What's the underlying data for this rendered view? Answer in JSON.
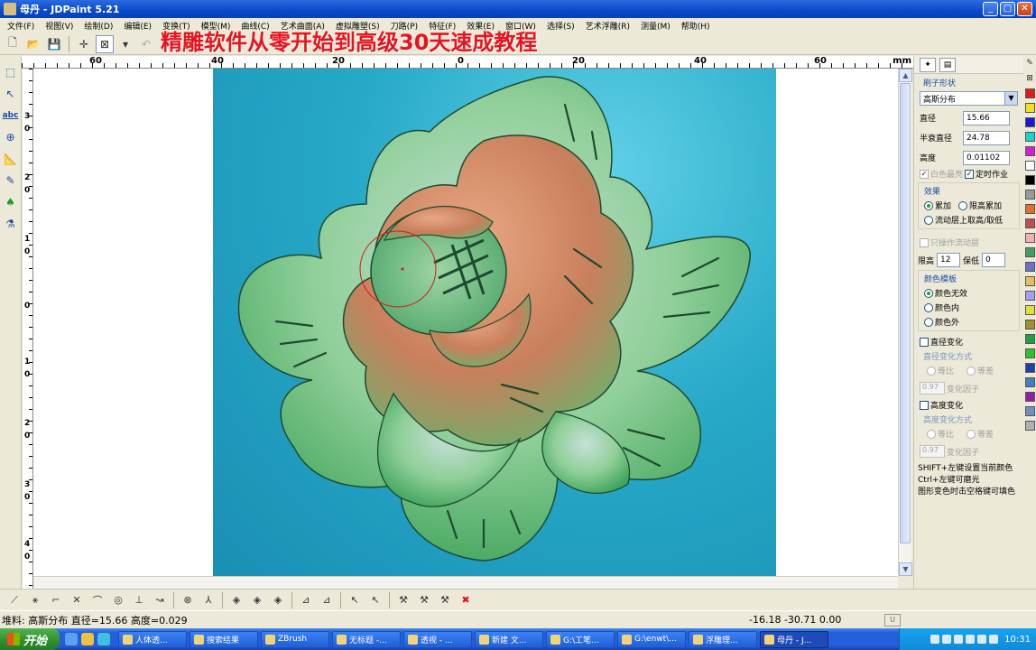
{
  "window": {
    "title": "母丹 - JDPaint 5.21"
  },
  "menu": [
    "文件(F)",
    "视图(V)",
    "绘制(D)",
    "编辑(E)",
    "变换(T)",
    "模型(M)",
    "曲线(C)",
    "艺术曲面(A)",
    "虚拟雕塑(S)",
    "刀路(P)",
    "特征(F)",
    "效果(E)",
    "窗口(W)",
    "选择(S)",
    "艺术浮雕(R)",
    "测量(M)",
    "帮助(H)"
  ],
  "caption": "精雕软件从零开始到高级30天速成教程",
  "ruler": {
    "unit": "mm",
    "top_labels": [
      "60",
      "40",
      "20",
      "0",
      "20",
      "40",
      "60"
    ],
    "left_labels": [
      "3",
      "0",
      "2",
      "0",
      "1",
      "0",
      "0",
      "1",
      "0",
      "2",
      "0",
      "3",
      "0",
      "4",
      "0"
    ]
  },
  "brush_panel": {
    "section_shape": "刷子形状",
    "shape_value": "高斯分布",
    "diameter_label": "直径",
    "diameter_value": "15.66",
    "half_decay_label": "半衰直径",
    "half_decay_value": "24.78",
    "height_label": "高度",
    "height_value": "0.01102",
    "white_bright_label": "白色最亮",
    "timed_work_label": "定时作业",
    "effect_label": "效果",
    "effect_add": "累加",
    "effect_limit_add": "限高累加",
    "effect_flow": "流动层上取高/取低",
    "only_flow_label": "只操作流动层",
    "limit_high_label": "限高",
    "limit_high_value": "12",
    "limit_low_label": "保低",
    "limit_low_value": "0",
    "color_template_label": "颜色模板",
    "color_none": "颜色无效",
    "color_inside": "颜色内",
    "color_outside": "颜色外",
    "diameter_change": "直径变化",
    "diameter_change_mode": "直径变化方式",
    "ratio": "等比",
    "difference": "等差",
    "change_factor_value": "0.97",
    "change_factor_label": "变化因子",
    "height_change": "高度变化",
    "height_change_mode": "高度变化方式",
    "hint1": "SHIFT+左键设置当前颜色",
    "hint2": "Ctrl+左键可磨光",
    "hint3": "图形变色时击空格键可填色"
  },
  "palette_colors": [
    "#d62020",
    "#f0e020",
    "#1a1ad0",
    "#1fd0d0",
    "#d020d0",
    "#ffffff",
    "#000000",
    "#9a9a9a",
    "#e07030",
    "#c05050",
    "#f0b0b0",
    "#40a060",
    "#7070c0",
    "#e0c060",
    "#a0a0ff",
    "#e0e040",
    "#a09030",
    "#20a040",
    "#30c030",
    "#2040a0",
    "#4080c0",
    "#9020a0",
    "#7090c0",
    "#b0b0b0"
  ],
  "status": {
    "left": "堆料: 高斯分布  直径=15.66  高度=0.029",
    "coords": "-16.18  -30.71  0.00"
  },
  "taskbar": {
    "start_label": "开始",
    "tasks": [
      "人体透...",
      "搜索结果",
      "ZBrush",
      "无标题 -...",
      "透视 - ...",
      "新建 文...",
      "G:\\工笔...",
      "G:\\enwt\\...",
      "浮雕理...",
      "母丹 - J..."
    ],
    "clock": "10:31"
  },
  "colors": {
    "caption": "#e8131c",
    "relief_bg": "#27a9c8",
    "title_bar": "#0a49c9"
  }
}
